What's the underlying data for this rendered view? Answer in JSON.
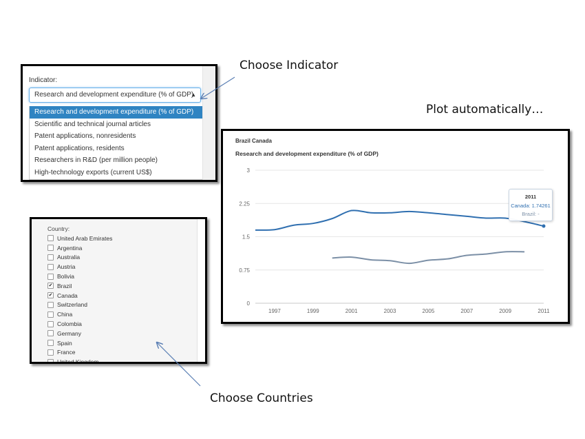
{
  "captions": {
    "choose_indicator": "Choose Indicator",
    "plot_automatically": "Plot automatically…",
    "choose_countries": "Choose Countries"
  },
  "indicator": {
    "label": "Indicator:",
    "selected": "Research and development expenditure (% of GDP)",
    "options": [
      "Research and development expenditure (% of GDP)",
      "Scientific and technical journal articles",
      "Patent applications, nonresidents",
      "Patent applications, residents",
      "Researchers in R&D (per million people)",
      "High-technology exports (current US$)"
    ],
    "highlighted_index": 0
  },
  "country": {
    "label": "Country:",
    "items": [
      {
        "name": "United Arab Emirates",
        "checked": false
      },
      {
        "name": "Argentina",
        "checked": false
      },
      {
        "name": "Australia",
        "checked": false
      },
      {
        "name": "Austria",
        "checked": false
      },
      {
        "name": "Bolivia",
        "checked": false
      },
      {
        "name": "Brazil",
        "checked": true
      },
      {
        "name": "Canada",
        "checked": true
      },
      {
        "name": "Switzerland",
        "checked": false
      },
      {
        "name": "China",
        "checked": false
      },
      {
        "name": "Colombia",
        "checked": false
      },
      {
        "name": "Germany",
        "checked": false
      },
      {
        "name": "Spain",
        "checked": false
      },
      {
        "name": "France",
        "checked": false
      },
      {
        "name": "United Kingdom",
        "checked": false
      }
    ]
  },
  "chart": {
    "subtitle": "Brazil Canada",
    "title": "Research and development expenditure (% of GDP)",
    "tooltip": {
      "year": "2011",
      "row1": "Canada: 1.74261",
      "row2": "Brazil: -"
    }
  },
  "chart_data": {
    "type": "line",
    "title": "Research and development expenditure (% of GDP)",
    "subtitle": "Brazil Canada",
    "xlabel": "",
    "ylabel": "",
    "xlim": [
      1996,
      2011
    ],
    "ylim": [
      0,
      3
    ],
    "x_ticks": [
      1997,
      1999,
      2001,
      2003,
      2005,
      2007,
      2009,
      2011
    ],
    "y_ticks": [
      0,
      0.75,
      1.5,
      2.25,
      3
    ],
    "y_tick_labels": [
      "0",
      "0.75",
      "1.5",
      "2.25",
      "3"
    ],
    "grid": true,
    "series": [
      {
        "name": "Canada",
        "color": "#2f6fb0",
        "x": [
          1996,
          1997,
          1998,
          1999,
          2000,
          2001,
          2002,
          2003,
          2004,
          2005,
          2006,
          2007,
          2008,
          2009,
          2010,
          2011
        ],
        "values": [
          1.65,
          1.66,
          1.76,
          1.8,
          1.91,
          2.09,
          2.04,
          2.04,
          2.07,
          2.04,
          2.0,
          1.96,
          1.92,
          1.92,
          1.84,
          1.74
        ]
      },
      {
        "name": "Brazil",
        "color": "#7b8fa6",
        "x": [
          2000,
          2001,
          2002,
          2003,
          2004,
          2005,
          2006,
          2007,
          2008,
          2009,
          2010
        ],
        "values": [
          1.02,
          1.04,
          0.98,
          0.96,
          0.9,
          0.97,
          1.0,
          1.08,
          1.11,
          1.16,
          1.16
        ]
      }
    ]
  },
  "colors": {
    "highlight": "#2f84c2",
    "focus_border": "#66afe9",
    "arrow": "#5b7fb4"
  }
}
